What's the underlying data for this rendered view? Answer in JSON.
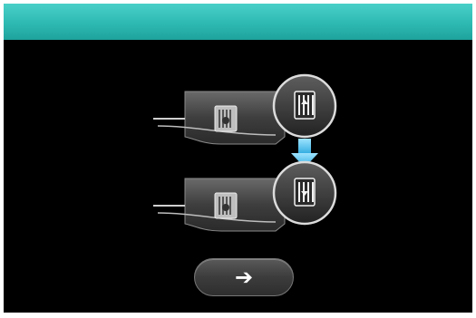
{
  "header": {
    "title": "",
    "color": "#2dbab3"
  },
  "illustration": {
    "description_icons": [
      "machine-bed-icon",
      "presser-foot-icon",
      "down-arrow-icon"
    ],
    "step_arrow_color": "#4fc4ee"
  },
  "next_button": {
    "icon": "right-arrow-icon",
    "glyph": "➔"
  }
}
